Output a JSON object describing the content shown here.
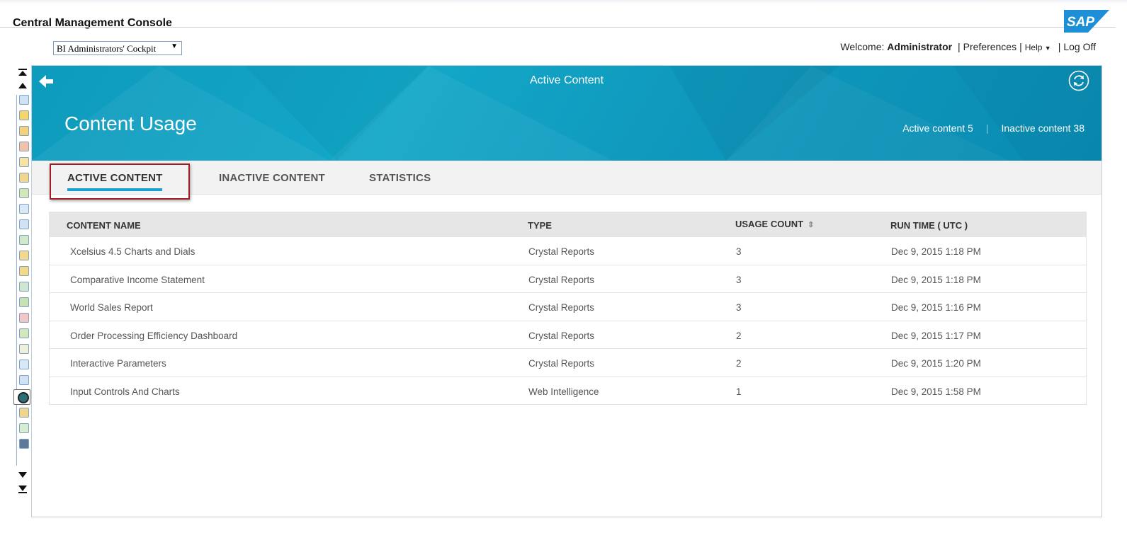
{
  "app": {
    "title": "Central Management Console",
    "logo_text": "SAP"
  },
  "app_selector": {
    "value": "BI Administrators' Cockpit"
  },
  "userbar": {
    "welcome_label": "Welcome:",
    "user": "Administrator",
    "preferences": "Preferences",
    "help": "Help",
    "logoff": "Log Off",
    "separator": "|"
  },
  "banner": {
    "breadcrumb": "Active Content",
    "title": "Content Usage",
    "active_count_label": "Active content 5",
    "inactive_count_label": "Inactive content 38",
    "divider": "|"
  },
  "tabs": [
    {
      "label": "ACTIVE CONTENT",
      "active": true
    },
    {
      "label": "INACTIVE CONTENT",
      "active": false
    },
    {
      "label": "STATISTICS",
      "active": false
    }
  ],
  "table": {
    "columns": [
      "CONTENT NAME",
      "TYPE",
      "USAGE COUNT",
      "RUN TIME ( UTC )"
    ],
    "rows": [
      {
        "name": "Xcelsius 4.5 Charts and Dials",
        "type": "Crystal Reports",
        "count": "3",
        "runtime": "Dec 9, 2015 1:18 PM"
      },
      {
        "name": "Comparative Income Statement",
        "type": "Crystal Reports",
        "count": "3",
        "runtime": "Dec 9, 2015 1:18 PM"
      },
      {
        "name": "World Sales Report",
        "type": "Crystal Reports",
        "count": "3",
        "runtime": "Dec 9, 2015 1:16 PM"
      },
      {
        "name": "Order Processing Efficiency Dashboard",
        "type": "Crystal Reports",
        "count": "2",
        "runtime": "Dec 9, 2015 1:17 PM"
      },
      {
        "name": "Interactive Parameters",
        "type": "Crystal Reports",
        "count": "2",
        "runtime": "Dec 9, 2015 1:20 PM"
      },
      {
        "name": "Input Controls And Charts",
        "type": "Web Intelligence",
        "count": "1",
        "runtime": "Dec 9, 2015 1:58 PM"
      }
    ]
  },
  "colors": {
    "banner": "#0e9bbd",
    "tab_underline": "#1aa1d2",
    "highlight_box": "#a01c24"
  },
  "icons": {
    "back": "arrow-left-icon",
    "refresh": "refresh-icon",
    "sort": "sort-icon",
    "rail_top": "double-chevron-up-icon",
    "rail_up": "chevron-up-icon",
    "rail_down": "chevron-down-icon",
    "rail_bottom": "double-chevron-down-icon"
  }
}
